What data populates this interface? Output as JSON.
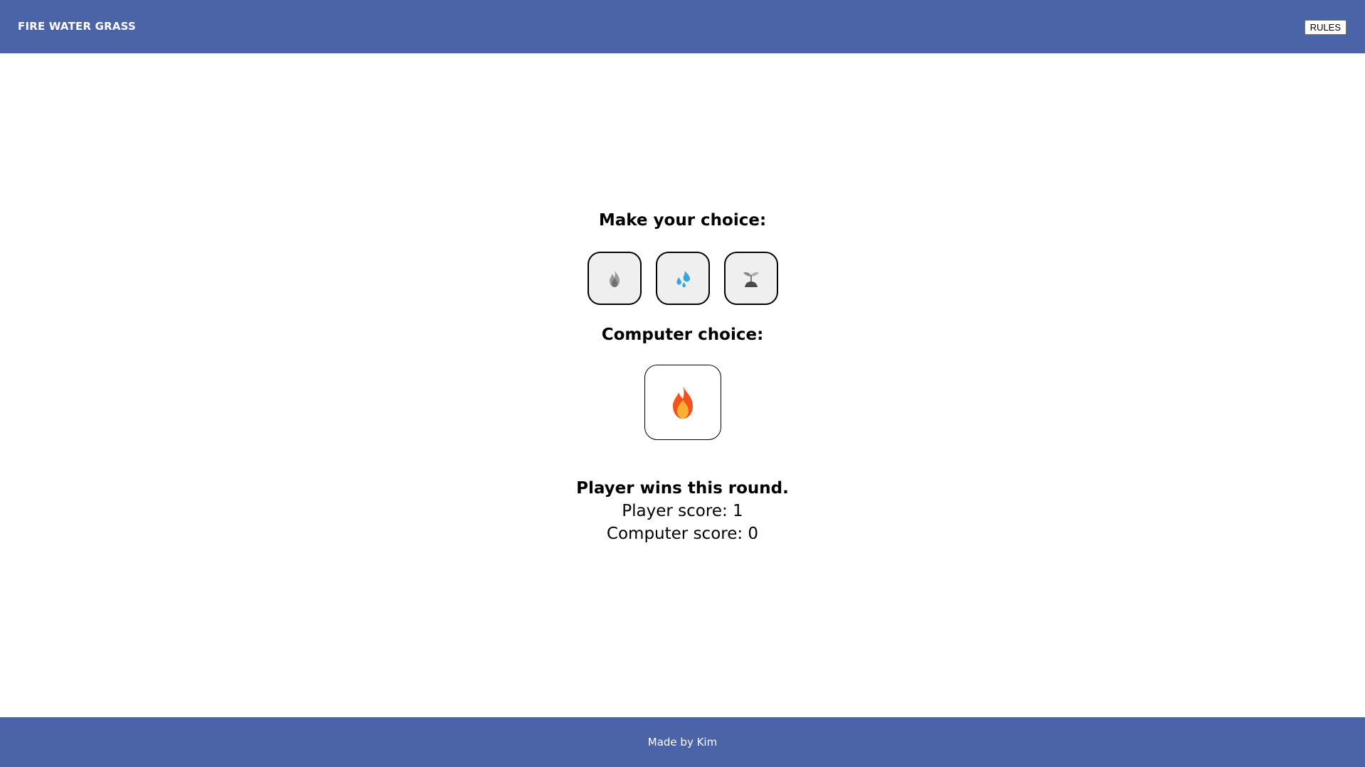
{
  "header": {
    "title": "FIRE WATER GRASS",
    "rules_label": "RULES",
    "background_color": "#4b64a8"
  },
  "game": {
    "player_prompt": "Make your choice:",
    "choices": [
      {
        "name": "fire",
        "icon": "fire-icon-grayscale"
      },
      {
        "name": "water",
        "icon": "water-droplets-icon"
      },
      {
        "name": "grass",
        "icon": "seedling-icon-grayscale"
      }
    ],
    "computer_prompt": "Computer choice:",
    "computer_choice": {
      "name": "fire",
      "icon": "fire-icon"
    },
    "result": "Player wins this round.",
    "player_score_label": "Player score: 1",
    "computer_score_label": "Computer score: 0"
  },
  "footer": {
    "text": "Made by Kim",
    "background_color": "#4b64a8"
  }
}
